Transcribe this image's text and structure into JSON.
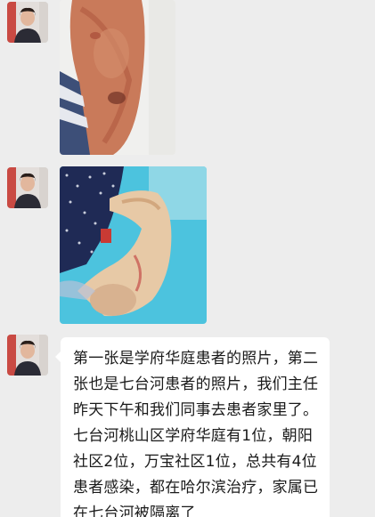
{
  "messages": [
    {
      "sender_avatar": "person-avatar",
      "type": "image",
      "image_content": "photo-injured-arm-1"
    },
    {
      "sender_avatar": "person-avatar",
      "type": "image",
      "image_content": "photo-injured-arm-2"
    },
    {
      "sender_avatar": "person-avatar",
      "type": "text",
      "text": "第一张是学府华庭患者的照片，第二张也是七台河患者的照片，我们主任昨天下午和我们同事去患者家里了。七台河桃山区学府华庭有1位，朝阳社区2位，万宝社区1位，总共有4位患者感染，都在哈尔滨治疗，家属已在七台河被隔离了"
    }
  ],
  "colors": {
    "chat_background": "#ededed",
    "bubble_background": "#ffffff",
    "text": "#1a1a1a",
    "photo2_bed_sheet": "#4cc3de"
  }
}
